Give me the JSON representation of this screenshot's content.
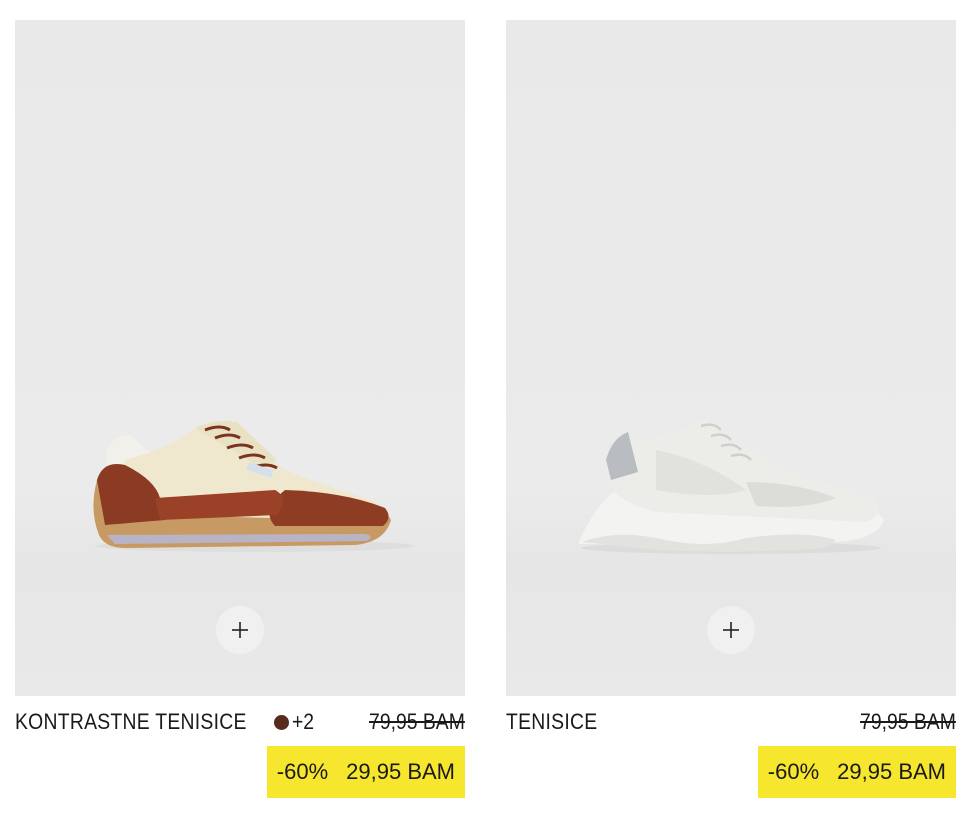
{
  "products": [
    {
      "name": "KONTRASTNE TENISICE",
      "swatch_color": "#5a2a1c",
      "more_colors": "+2",
      "old_price": "79,95 BAM",
      "discount": "-60%",
      "sale_price": "29,95 BAM",
      "add_icon": "plus-icon"
    },
    {
      "name": "TENISICE",
      "old_price": "79,95 BAM",
      "discount": "-60%",
      "sale_price": "29,95 BAM",
      "add_icon": "plus-icon"
    }
  ],
  "colors": {
    "badge": "#f6e62d",
    "image_bg": "#e9e9e9",
    "text": "#1a1a1a"
  }
}
